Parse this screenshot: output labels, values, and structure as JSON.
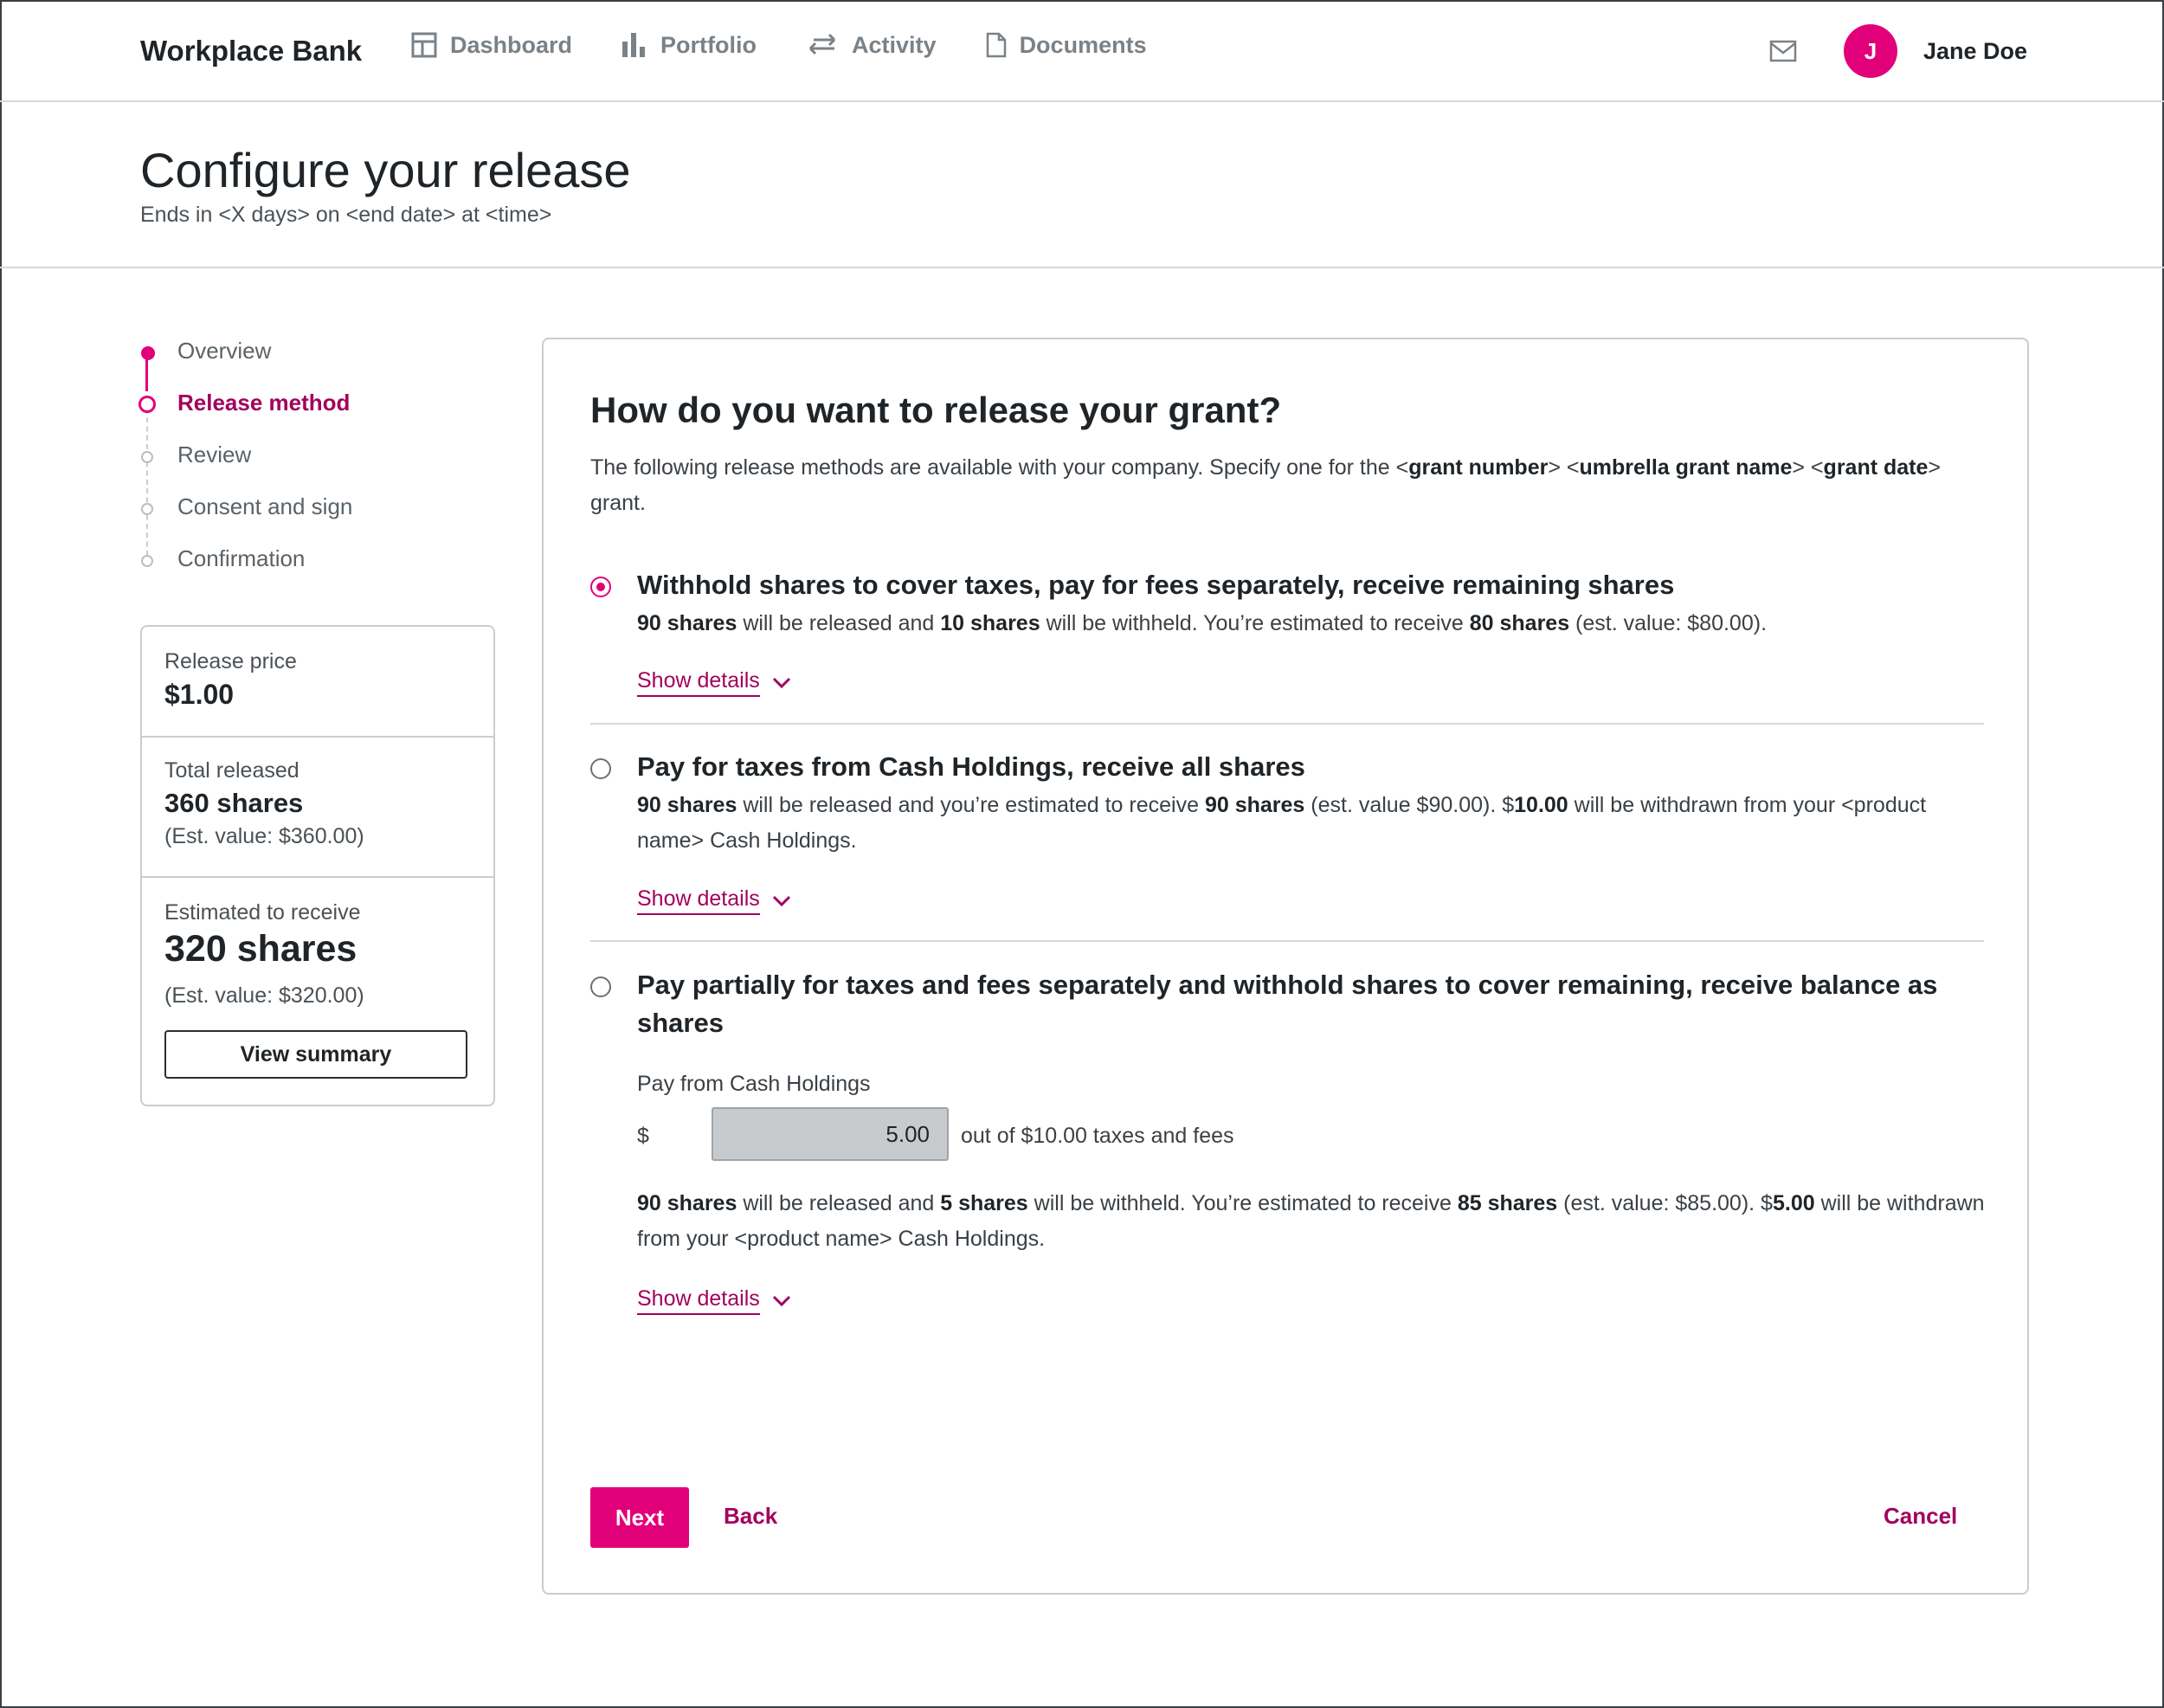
{
  "app": {
    "brand": "Workplace Bank",
    "nav": [
      {
        "label": "Dashboard",
        "icon": "dashboard-icon"
      },
      {
        "label": "Portfolio",
        "icon": "bar-chart-icon"
      },
      {
        "label": "Activity",
        "icon": "swap-arrows-icon"
      },
      {
        "label": "Documents",
        "icon": "document-icon"
      }
    ],
    "user": {
      "initial": "J",
      "name": "Jane Doe"
    },
    "colors": {
      "accent": "#e2007a",
      "accent_dark": "#a3005c",
      "text": "#1f2428",
      "muted": "#7a8288"
    }
  },
  "page": {
    "title": "Configure your release",
    "subtitle": "Ends in <X days> on <end date> at <time>"
  },
  "stepper": {
    "steps": [
      {
        "label": "Overview",
        "state": "done"
      },
      {
        "label": "Release method",
        "state": "current"
      },
      {
        "label": "Review",
        "state": "upcoming"
      },
      {
        "label": "Consent and sign",
        "state": "upcoming"
      },
      {
        "label": "Confirmation",
        "state": "upcoming"
      }
    ]
  },
  "summary": {
    "release_price_label": "Release price",
    "release_price": "$1.00",
    "total_released_label": "Total released",
    "total_released": "360 shares",
    "total_released_est": "(Est. value: $360.00)",
    "estimated_label": "Estimated to receive",
    "estimated": "320 shares",
    "estimated_est": "(Est. value: $320.00)",
    "view_summary": "View summary"
  },
  "main": {
    "heading": "How do you want to release your grant?",
    "description": {
      "before": "The following release methods are available with your company. Specify one for the <",
      "grant_number": "grant number",
      "mid1": "> <",
      "umbrella": "umbrella grant name",
      "mid2": "> <",
      "grant_date": "grant date",
      "after": "> grant."
    },
    "options": [
      {
        "title": "Withhold shares to cover taxes, pay for fees separately, receive remaining shares",
        "selected": true,
        "b1": "90 shares",
        "t1": " will be released and ",
        "b2": "10 shares",
        "t2": " will be withheld. You’re estimated to receive ",
        "b3": "80 shares",
        "t3": " (est. value: $80.00).",
        "details": "Show details"
      },
      {
        "title": "Pay for taxes from Cash Holdings, receive all shares",
        "selected": false,
        "b1": "90 shares",
        "t1": " will be released and you’re estimated to receive ",
        "b2": "90 shares",
        "t2": " (est. value $90.00). $",
        "b3": "10.00",
        "t3": " will be withdrawn from your <product name> Cash Holdings.",
        "details": "Show details"
      },
      {
        "title": "Pay partially for taxes and fees separately and withhold shares to cover remaining, receive balance as shares",
        "selected": false,
        "pay_label": "Pay from Cash Holdings",
        "currency": "$",
        "amount": "5.00",
        "out_of": "out of $10.00 taxes and fees",
        "b1": "90 shares",
        "t1": " will be released and ",
        "b2": "5 shares",
        "t2": " will be withheld. You’re estimated to receive ",
        "b3": "85 shares",
        "t3": " (est. value: $85.00). $",
        "b4": "5.00",
        "t4": " will be withdrawn from your <product name> Cash Holdings.",
        "details": "Show details"
      }
    ],
    "next": "Next",
    "back": "Back",
    "cancel": "Cancel"
  }
}
